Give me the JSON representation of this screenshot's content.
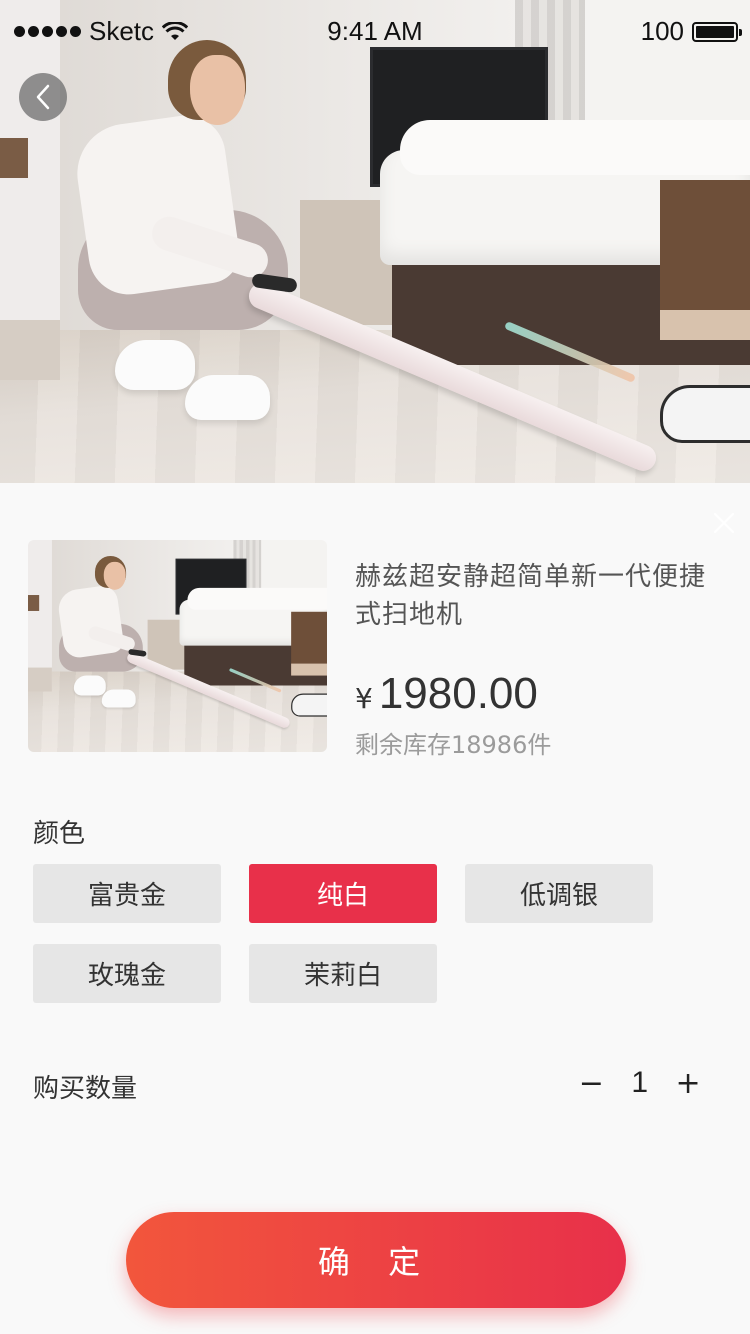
{
  "status_bar": {
    "carrier": "Sketc",
    "time": "9:41 AM",
    "battery": "100",
    "battery_level": 1.0,
    "icons": [
      "signal-dots-icon",
      "wifi-icon",
      "battery-icon"
    ]
  },
  "hero": {
    "image_desc": "product-photo"
  },
  "nav": {
    "back_icon": "chevron-left-icon"
  },
  "sheet": {
    "close_icon": "close-icon",
    "product": {
      "title": "赫兹超安静超简单新一代便捷式扫地机",
      "currency": "¥",
      "price": "1980.00",
      "stock": "剩余库存18986件"
    },
    "color": {
      "label": "颜色",
      "options": [
        {
          "label": "富贵金",
          "selected": false
        },
        {
          "label": "纯白",
          "selected": true
        },
        {
          "label": "低调银",
          "selected": false
        },
        {
          "label": "玫瑰金",
          "selected": false
        },
        {
          "label": "茉莉白",
          "selected": false
        }
      ]
    },
    "quantity": {
      "label": "购买数量",
      "minus": "−",
      "value": "1",
      "plus": "+"
    },
    "confirm_label": "确 定"
  },
  "colors": {
    "accent": "#e8304a",
    "accent_gradient_start": "#f2563c",
    "option_bg": "#e6e6e6",
    "sheet_bg": "#f9f9f9"
  }
}
